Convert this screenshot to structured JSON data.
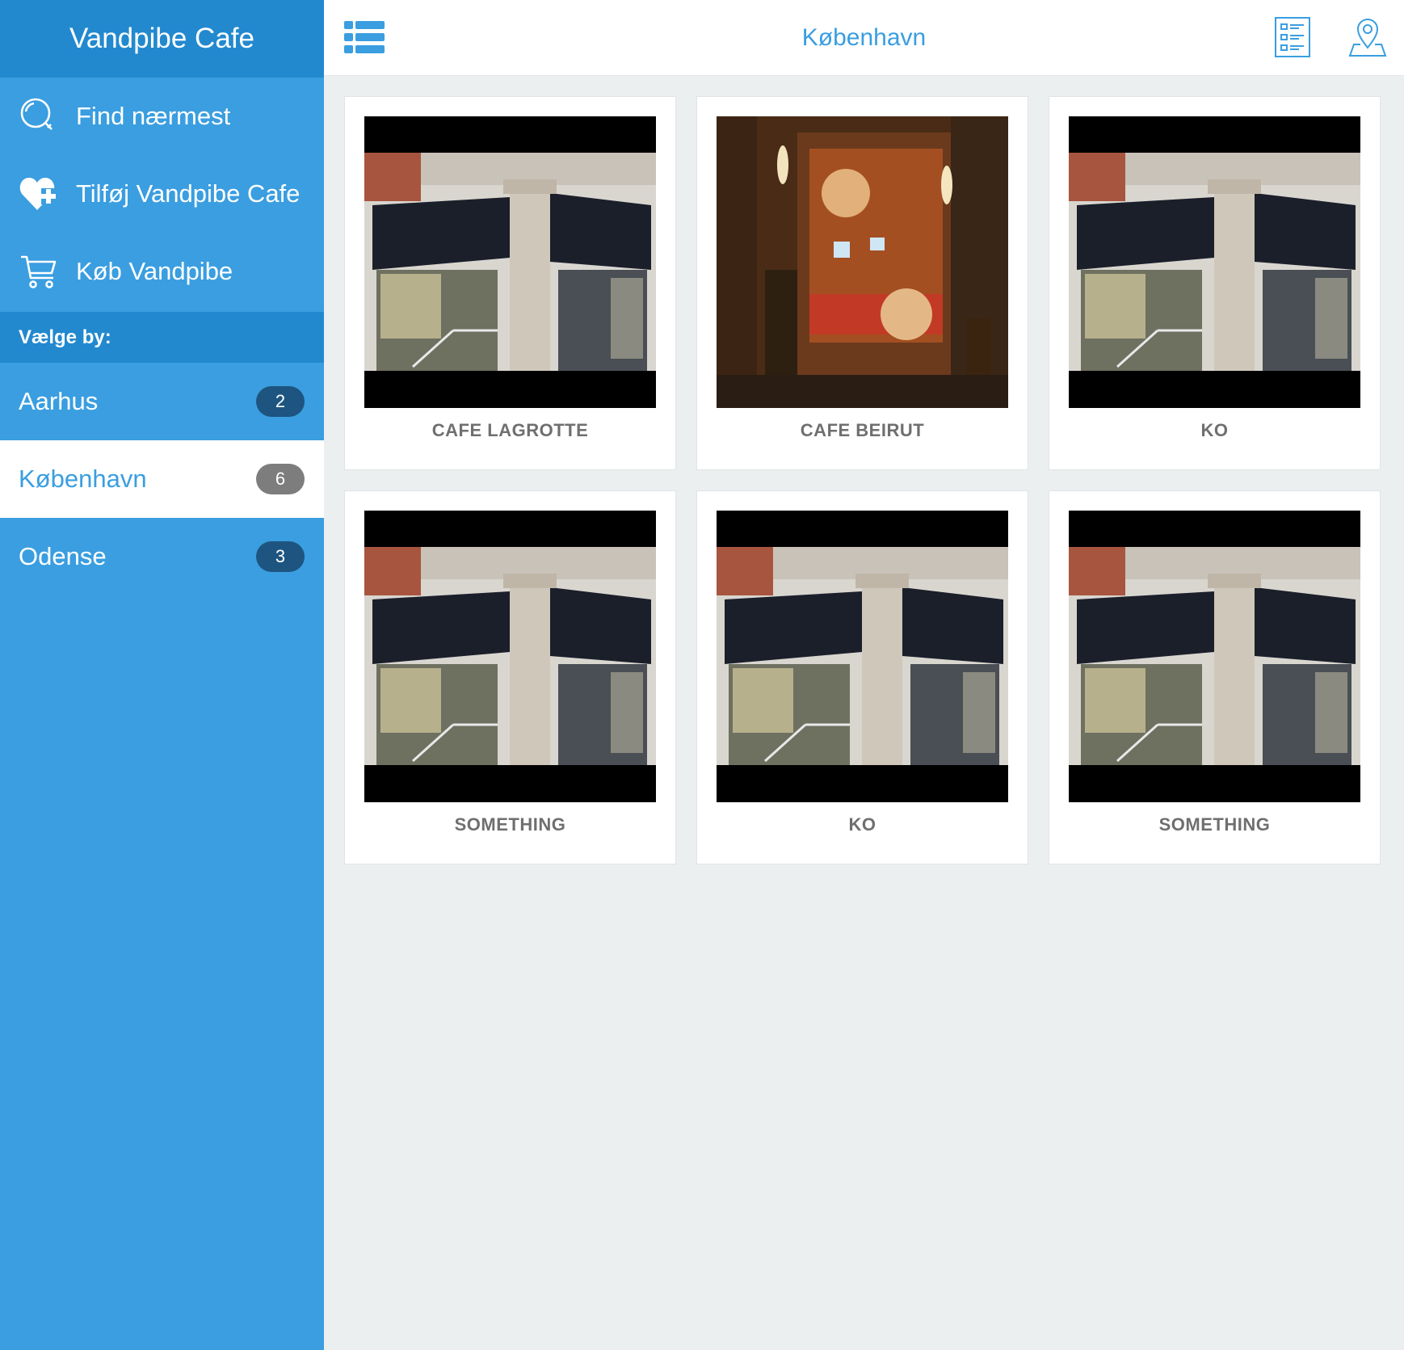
{
  "app_title": "Vandpibe Cafe",
  "menu": [
    {
      "label": "Find nærmest",
      "icon": "search-icon"
    },
    {
      "label": "Tilføj Vandpibe Cafe",
      "icon": "heart-plus-icon"
    },
    {
      "label": "Køb Vandpibe",
      "icon": "cart-icon"
    }
  ],
  "city_section_label": "Vælge by:",
  "cities": [
    {
      "name": "Aarhus",
      "count": "2",
      "active": false
    },
    {
      "name": "København",
      "count": "6",
      "active": true
    },
    {
      "name": "Odense",
      "count": "3",
      "active": false
    }
  ],
  "topbar": {
    "title": "København",
    "left_icon": "list-menu-icon",
    "right_icons": [
      "list-view-icon",
      "map-pin-icon"
    ]
  },
  "cafes": [
    {
      "name": "CAFE LAGROTTE",
      "image": "shisha-corner-photo"
    },
    {
      "name": "CAFE BEIRUT",
      "image": "cafe-beirut-photo"
    },
    {
      "name": "KO",
      "image": "shisha-corner-photo"
    },
    {
      "name": "SOMETHING",
      "image": "shisha-corner-photo"
    },
    {
      "name": "KO",
      "image": "shisha-corner-photo"
    },
    {
      "name": "SOMETHING",
      "image": "shisha-corner-photo"
    }
  ],
  "colors": {
    "accent": "#3a9ee0",
    "sidebar_header": "#2289cf",
    "badge": "#1d5580",
    "badge_active": "#7d7d7d",
    "background": "#eceff0"
  }
}
